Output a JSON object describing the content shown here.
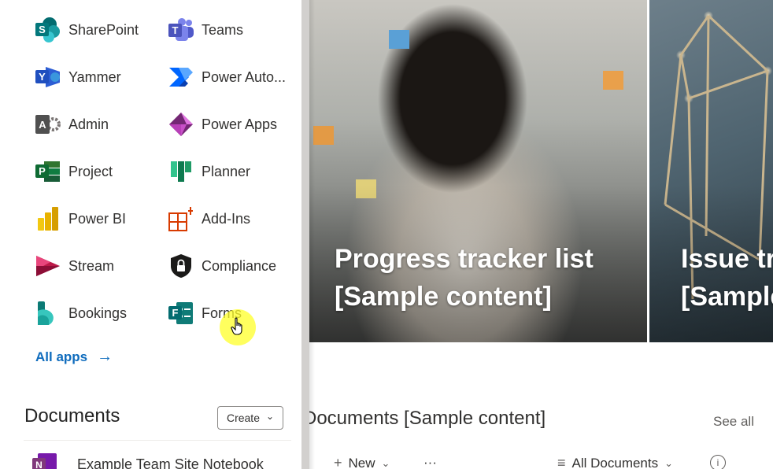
{
  "app_launcher": {
    "apps": [
      {
        "label": "SharePoint",
        "icon": "sharepoint-icon"
      },
      {
        "label": "Teams",
        "icon": "teams-icon"
      },
      {
        "label": "Yammer",
        "icon": "yammer-icon"
      },
      {
        "label": "Power Auto...",
        "icon": "power-automate-icon"
      },
      {
        "label": "Admin",
        "icon": "admin-icon"
      },
      {
        "label": "Power Apps",
        "icon": "power-apps-icon"
      },
      {
        "label": "Project",
        "icon": "project-icon"
      },
      {
        "label": "Planner",
        "icon": "planner-icon"
      },
      {
        "label": "Power BI",
        "icon": "power-bi-icon"
      },
      {
        "label": "Add-Ins",
        "icon": "add-ins-icon"
      },
      {
        "label": "Stream",
        "icon": "stream-icon"
      },
      {
        "label": "Compliance",
        "icon": "compliance-icon"
      },
      {
        "label": "Bookings",
        "icon": "bookings-icon"
      },
      {
        "label": "Forms",
        "icon": "forms-icon"
      }
    ],
    "all_apps_label": "All apps",
    "all_apps_arrow": "→"
  },
  "documents_panel": {
    "title": "Documents",
    "create_label": "Create",
    "create_chevron": "⌄",
    "recent": [
      {
        "label": "Example Team Site Notebook",
        "icon": "onenote-icon"
      }
    ]
  },
  "site_page": {
    "hero": [
      {
        "line1": "Progress tracker list",
        "line2": "[Sample content]"
      },
      {
        "line1": "Issue tra",
        "line2": "[Sample"
      }
    ],
    "documents_heading": "Documents [Sample content]",
    "see_all": "See all",
    "command_bar": {
      "new_label": "New",
      "more_label": "···",
      "view_label": "All Documents",
      "info_label": "i"
    }
  },
  "colors": {
    "link_blue": "#0f6cbd",
    "panel_edge": "#d2d0ce",
    "click_highlight": "#ffff28"
  }
}
